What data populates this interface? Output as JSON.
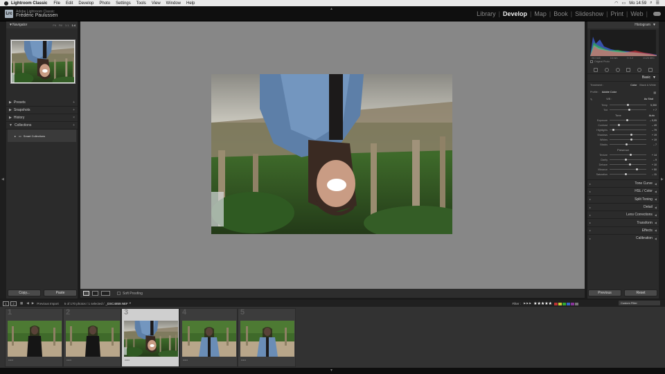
{
  "menubar": {
    "app": "Lightroom Classic",
    "items": [
      "File",
      "Edit",
      "Develop",
      "Photo",
      "Settings",
      "Tools",
      "View",
      "Window",
      "Help"
    ],
    "clock": "Mo 14:59"
  },
  "identity": {
    "badge": "Lrc",
    "product": "Adobe Lightroom Classic",
    "user": "Frédéric Paulussen"
  },
  "modules": {
    "items": [
      "Library",
      "Develop",
      "Map",
      "Book",
      "Slideshow",
      "Print",
      "Web"
    ],
    "active": "Develop"
  },
  "left_panel": {
    "navigator": {
      "label": "Navigator",
      "zooms": [
        "Fit",
        "Fill",
        "1:1",
        "1:4"
      ],
      "active_zoom": "1:4"
    },
    "sections": [
      {
        "label": "Presets",
        "has_plus": true
      },
      {
        "label": "Snapshots",
        "has_plus": true
      },
      {
        "label": "History",
        "has_plus": true
      },
      {
        "label": "Collections",
        "has_plus": true
      }
    ],
    "collections_item": "Smart Collections",
    "copy_button": "Copy...",
    "paste_button": "Paste"
  },
  "toolbar": {
    "soft_proofing": "Soft Proofing"
  },
  "right_panel": {
    "histogram": {
      "label": "Histogram",
      "iso": "ISO 640",
      "focal": "16 mm",
      "aperture": "f / 2.2",
      "shutter": "1/125 SEC",
      "original_photo": "Original Photo"
    },
    "basic": {
      "label": "Basic",
      "treatment_label": "Treatment :",
      "treatment_color": "Color",
      "treatment_bw": "Black & White",
      "profile_label": "Profile :",
      "profile_value": "Adobe Color",
      "wb_label": "WB :",
      "wb_value": "As Shot",
      "temp": {
        "label": "Temp",
        "value": "5,350",
        "pos": 0.5
      },
      "tint": {
        "label": "Tint",
        "value": "+ 7",
        "pos": 0.53
      },
      "tone_label": "Tone",
      "auto_label": "Auto",
      "exposure": {
        "label": "Exposure",
        "value": "– 0,05",
        "pos": 0.49
      },
      "contrast": {
        "label": "Contrast",
        "value": "– 49",
        "pos": 0.26
      },
      "highlights": {
        "label": "Highlights",
        "value": "– 79",
        "pos": 0.1
      },
      "shadows": {
        "label": "Shadows",
        "value": "+ 19",
        "pos": 0.6
      },
      "whites": {
        "label": "Whites",
        "value": "+ 19",
        "pos": 0.6
      },
      "blacks": {
        "label": "Blacks",
        "value": "– 7",
        "pos": 0.46
      },
      "presence_label": "Presence",
      "texture": {
        "label": "Texture",
        "value": "+ 14",
        "pos": 0.57
      },
      "clarity": {
        "label": "Clarity",
        "value": "– 9",
        "pos": 0.45
      },
      "dehaze": {
        "label": "Dehaze",
        "value": "+ 10",
        "pos": 0.55
      },
      "vibrance": {
        "label": "Vibrance",
        "value": "+ 50",
        "pos": 0.75
      },
      "saturation": {
        "label": "Saturation",
        "value": "– 11",
        "pos": 0.44
      }
    },
    "sections": [
      "Tone Curve",
      "HSL / Color",
      "Split Toning",
      "Detail",
      "Lens Corrections",
      "Transform",
      "Effects",
      "Calibration"
    ],
    "previous_button": "Previous",
    "reset_button": "Reset"
  },
  "filmstrip_bar": {
    "screen1": "1",
    "screen2": "2",
    "source": "Previous Import",
    "count": "5 of 170 photos / 1 selected /",
    "filename": "_DSC4859.NEF",
    "filter_label": "Filter :",
    "custom_filter": "Custom Filter"
  },
  "filmstrip": {
    "thumbs": [
      {
        "num": "1",
        "stars": "•••••",
        "selected": false
      },
      {
        "num": "2",
        "stars": "•••••",
        "selected": false
      },
      {
        "num": "3",
        "stars": "•••••",
        "selected": true
      },
      {
        "num": "4",
        "stars": "•••••",
        "selected": false
      },
      {
        "num": "5",
        "stars": "•••••",
        "selected": false
      }
    ]
  },
  "colors": {
    "active_module": "#eeeeee",
    "panel_bg": "#2b2b2b",
    "canvas_bg": "#878787",
    "selected_thumb": "#cfcfcf"
  }
}
